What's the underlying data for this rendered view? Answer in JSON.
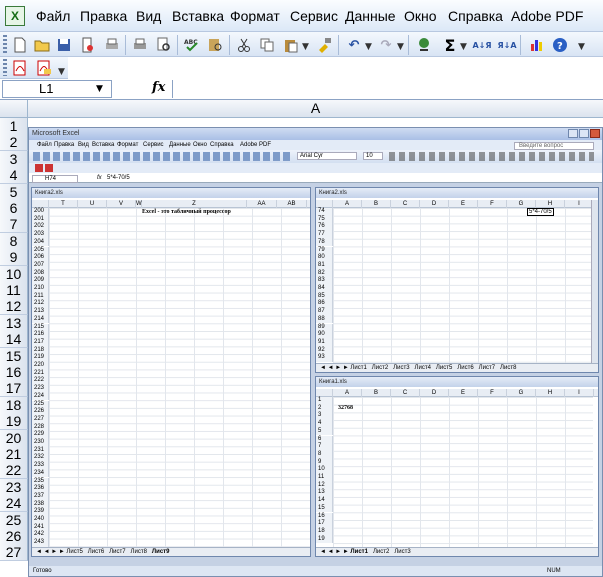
{
  "app": {
    "icon": "X"
  },
  "menu": [
    "Файл",
    "Правка",
    "Вид",
    "Вставка",
    "Формат",
    "Сервис",
    "Данные",
    "Окно",
    "Справка",
    "Adobe PDF"
  ],
  "formula_bar": {
    "name_box": "L1",
    "fx": "fx",
    "value": ""
  },
  "column_header": "A",
  "rows": [
    "1",
    "2",
    "3",
    "4",
    "5",
    "6",
    "7",
    "8",
    "9",
    "10",
    "11",
    "12",
    "13",
    "14",
    "15",
    "16",
    "17",
    "18",
    "19",
    "20",
    "21",
    "22",
    "23",
    "24",
    "25",
    "26",
    "27"
  ],
  "embedded": {
    "title": "Microsoft Excel",
    "menu": [
      "Файл",
      "Правка",
      "Вид",
      "Вставка",
      "Формат",
      "Сервис",
      "Данные",
      "Окно",
      "Справка",
      "Adobe PDF"
    ],
    "help_placeholder": "Введите вопрос",
    "font_name": "Arial Cyr",
    "font_size": "10",
    "name_box": "H74",
    "formula": "5*4-70/5",
    "status": "Готово",
    "status_num": "NUM",
    "left_window": {
      "title": "Книга2.xls",
      "cols": [
        "T",
        "U",
        "V",
        "W",
        "Z",
        "AA",
        "AB"
      ],
      "first_row": 200,
      "cell_text": "Excel - это табличный процессор",
      "tabs": [
        "Лист5",
        "Лист6",
        "Лист7",
        "Лист8",
        "Лист9"
      ],
      "active_tab": "Лист9"
    },
    "right_top_window": {
      "title": "Книга2.xls",
      "cols": [
        "A",
        "B",
        "C",
        "D",
        "E",
        "F",
        "G",
        "H",
        "I"
      ],
      "first_row": 74,
      "cell_text": "5*4-70/5",
      "tabs": [
        "Лист1",
        "Лист2",
        "Лист3",
        "Лист4",
        "Лист5",
        "Лист6",
        "Лист7",
        "Лист8"
      ]
    },
    "right_bottom_window": {
      "title": "Книга1.xls",
      "cols": [
        "A",
        "B",
        "C",
        "D",
        "E",
        "F",
        "G",
        "H",
        "I"
      ],
      "first_row": 1,
      "cell_text": "32768",
      "tabs": [
        "Лист1",
        "Лист2",
        "Лист3"
      ],
      "active_tab": "Лист1"
    }
  }
}
